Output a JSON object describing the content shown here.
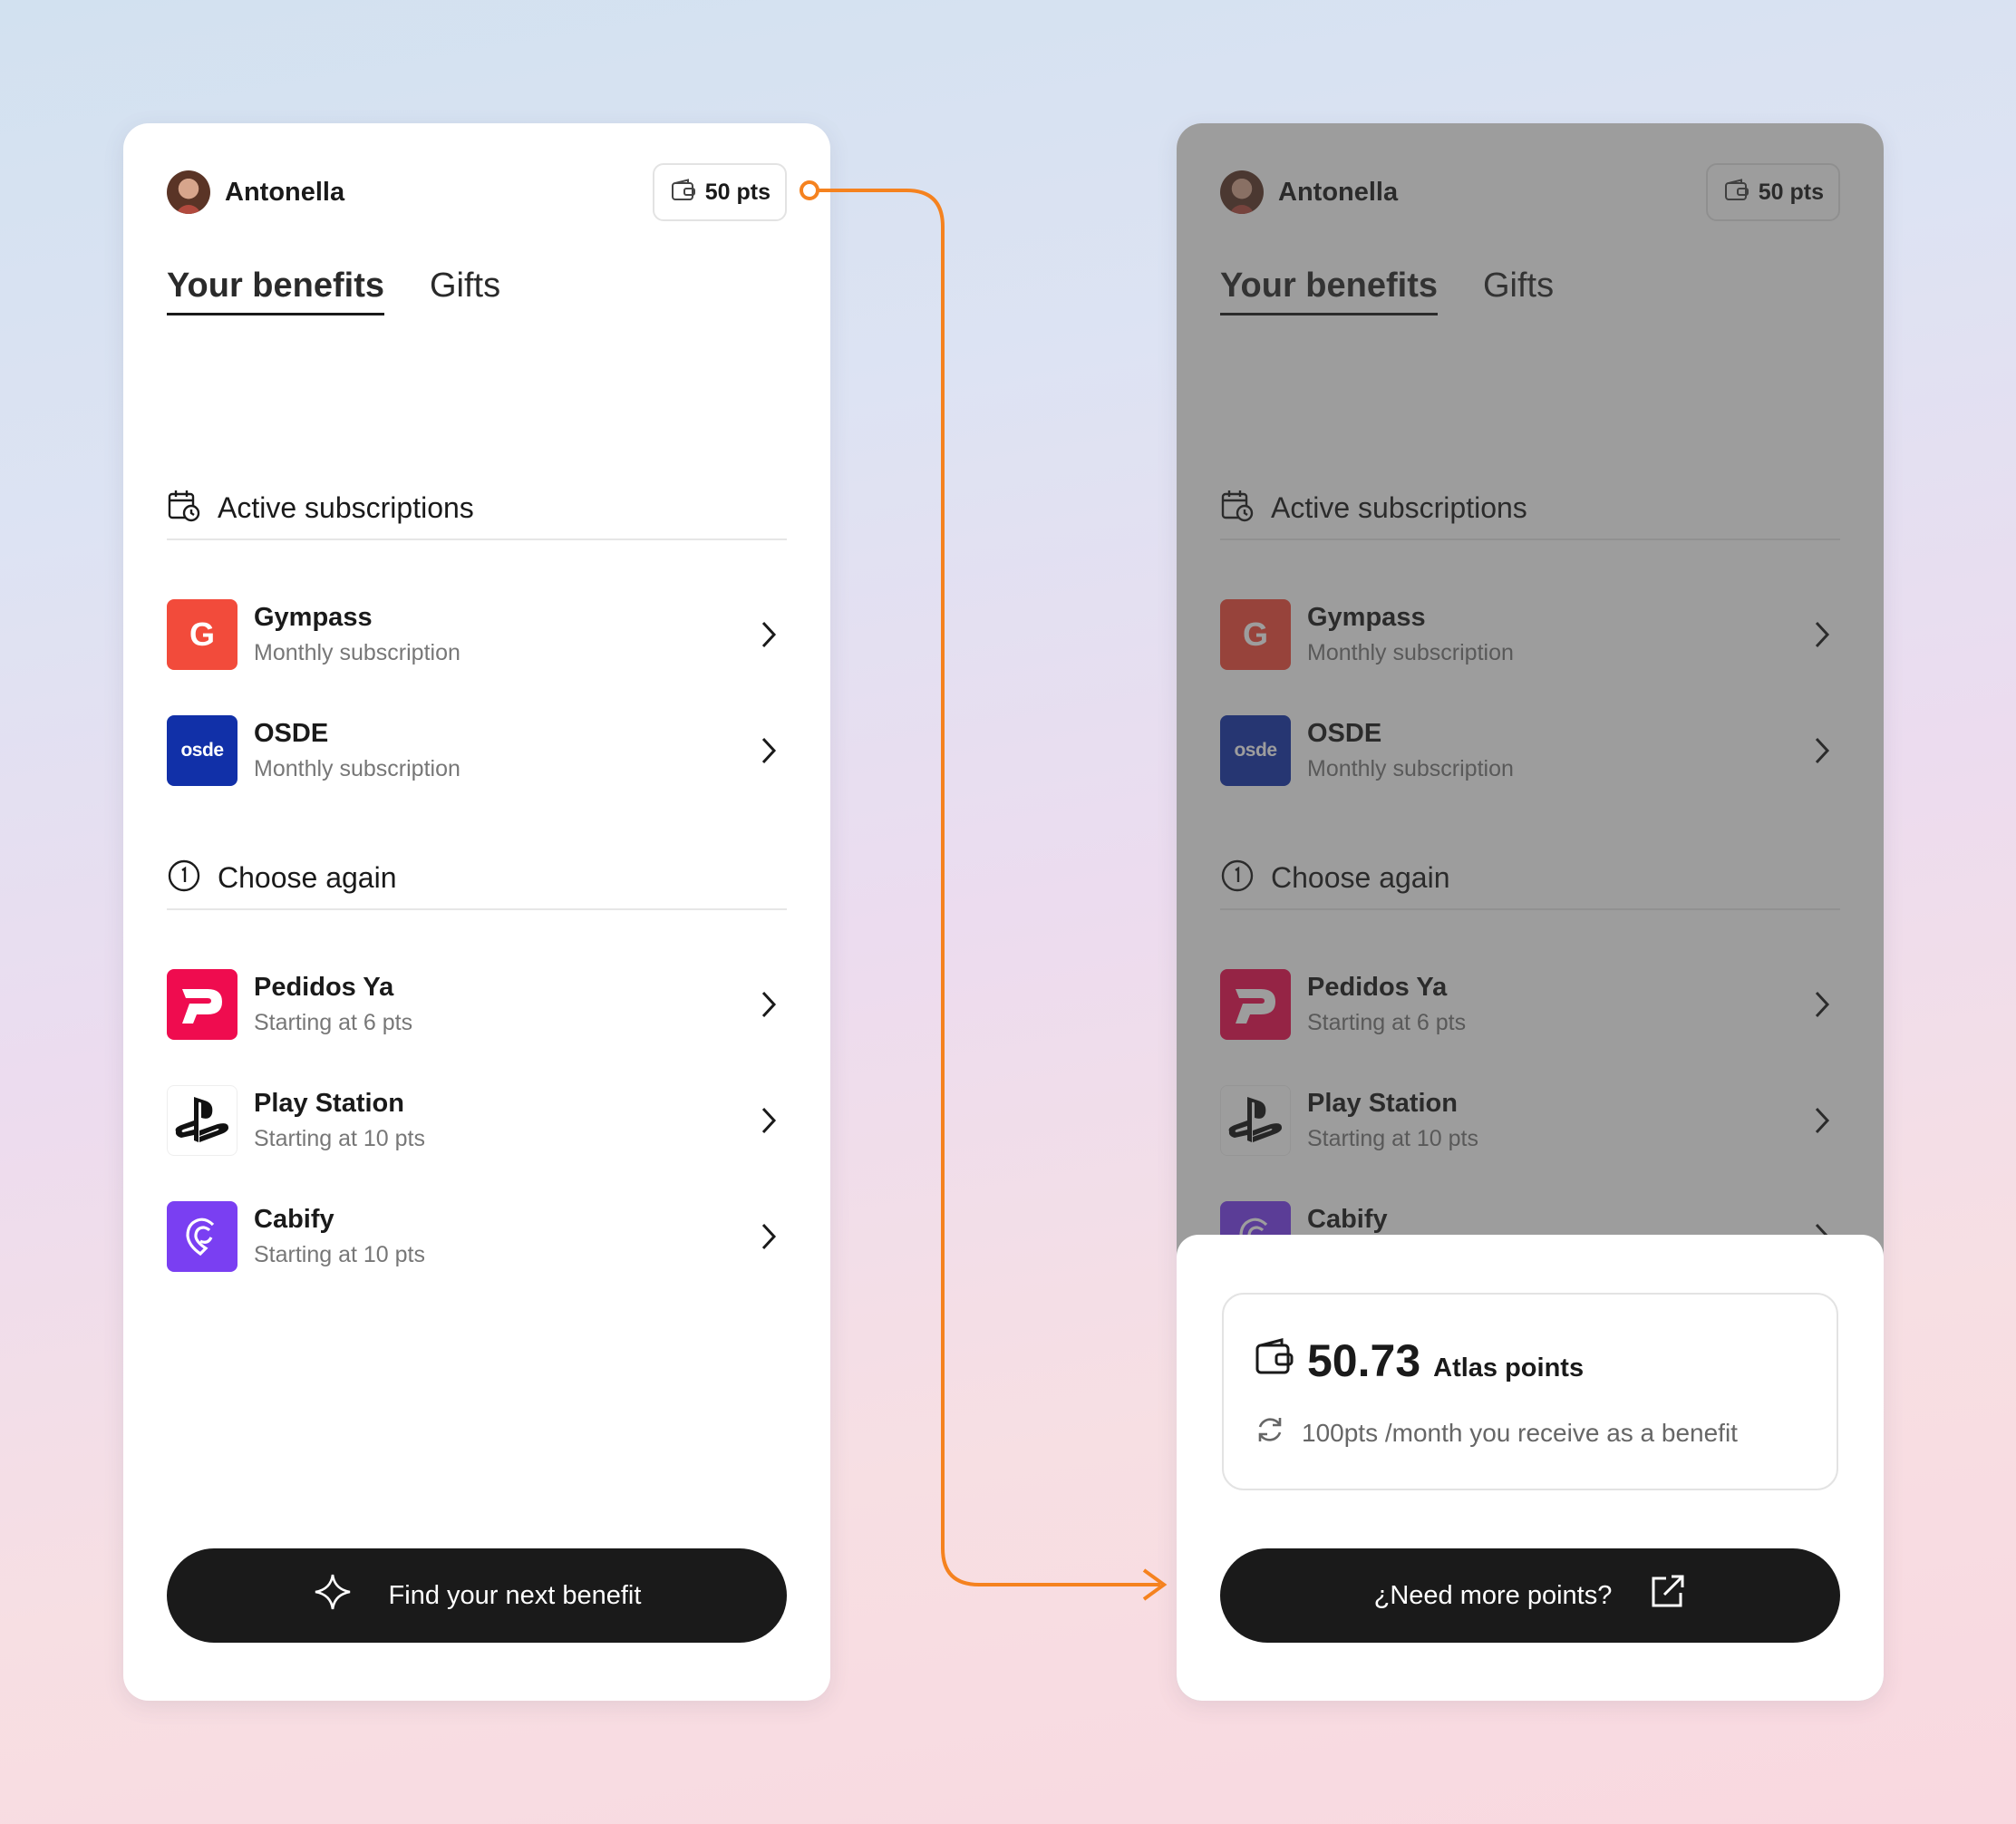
{
  "user": {
    "name": "Antonella",
    "points_badge": "50 pts"
  },
  "tabs": [
    {
      "label": "Your benefits"
    },
    {
      "label": "Gifts"
    }
  ],
  "sections": {
    "active": {
      "title": "Active subscriptions",
      "items": [
        {
          "title": "Gympass",
          "subtitle": "Monthly subscription",
          "logo_text": "G"
        },
        {
          "title": "OSDE",
          "subtitle": "Monthly subscription",
          "logo_text": "osde"
        }
      ]
    },
    "choose": {
      "title": "Choose again",
      "items": [
        {
          "title": "Pedidos Ya",
          "subtitle": "Starting at 6 pts"
        },
        {
          "title": "Play Station",
          "subtitle": "Starting at 10 pts"
        },
        {
          "title": "Cabify",
          "subtitle": "Starting at 10 pts"
        }
      ]
    }
  },
  "left_cta": {
    "label": "Find your next benefit"
  },
  "sheet": {
    "points_value": "50.73",
    "points_unit": "Atlas points",
    "points_note": "100pts /month you receive as a benefit",
    "cta_label": "¿Need more points?"
  },
  "colors": {
    "connector": "#f5821f",
    "gympass": "#f24b3b",
    "osde": "#1130a8",
    "pedidosya": "#ef0c4f",
    "cabify": "#7a3ff2",
    "cta": "#1a1a1a"
  },
  "icons": [
    "wallet-icon",
    "calendar-clock-icon",
    "history-icon",
    "chevron-right-icon",
    "sparkle-icon",
    "refresh-icon",
    "external-link-icon"
  ]
}
